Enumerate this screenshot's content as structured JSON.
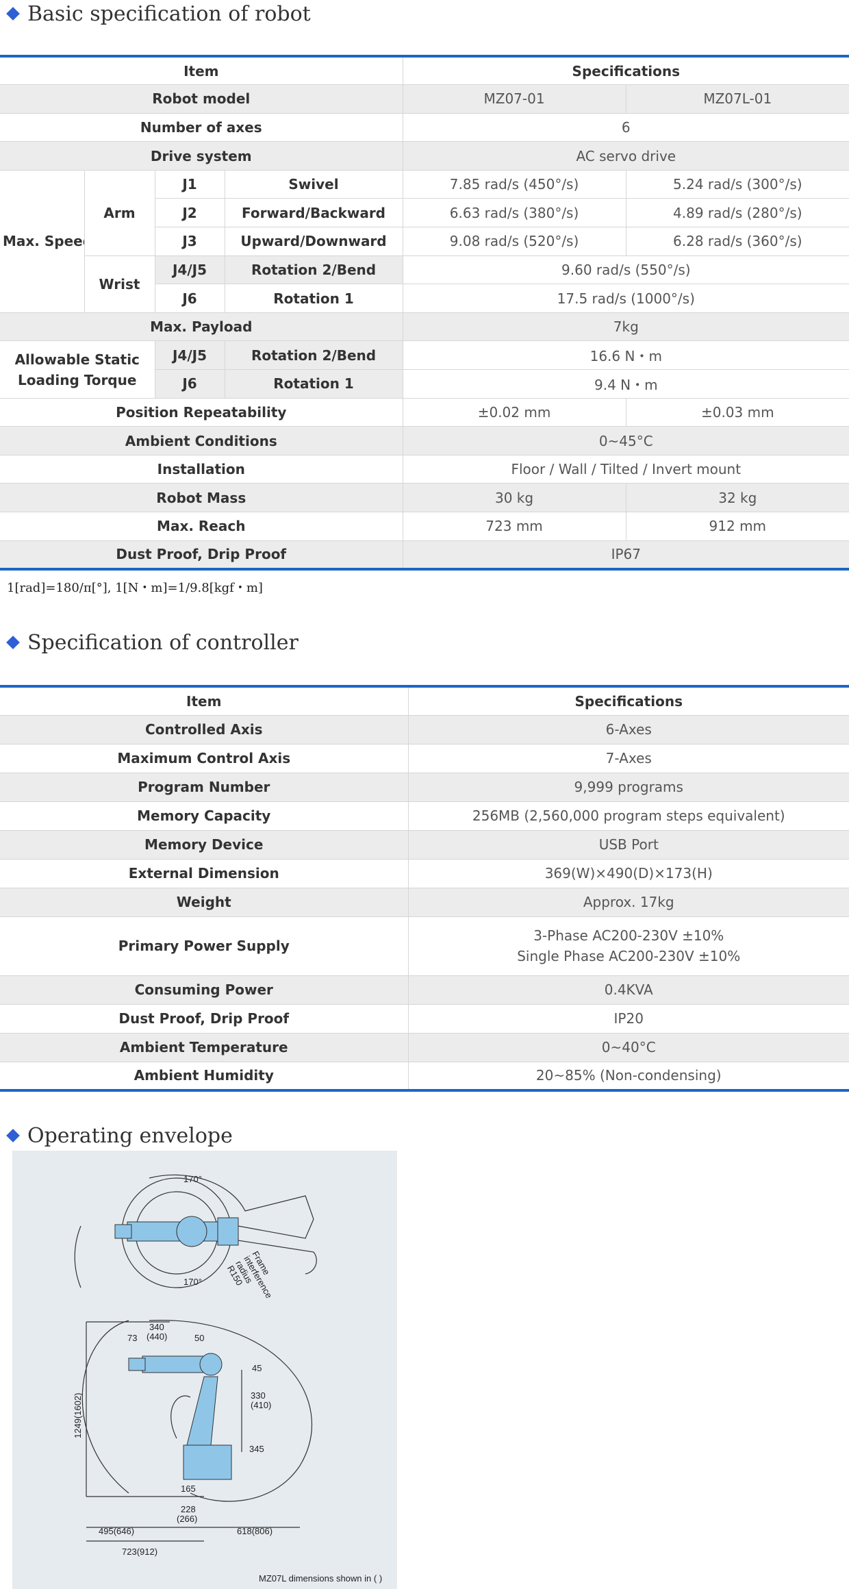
{
  "sections": {
    "robot_title": "Basic specification of robot",
    "controller_title": "Specification of controller",
    "envelope_title": "Operating envelope"
  },
  "robot": {
    "header": {
      "item": "Item",
      "spec": "Specifications"
    },
    "model": {
      "label": "Robot model",
      "a": "MZ07-01",
      "b": "MZ07L-01"
    },
    "axes": {
      "label": "Number of axes",
      "value": "6"
    },
    "drive": {
      "label": "Drive system",
      "value": "AC servo drive"
    },
    "max_speed": {
      "label": "Max. Speed",
      "arm_label": "Arm",
      "wrist_label": "Wrist",
      "j1": {
        "joint": "J1",
        "motion": "Swivel",
        "a": "7.85 rad/s (450°/s)",
        "b": "5.24 rad/s (300°/s)"
      },
      "j2": {
        "joint": "J2",
        "motion": "Forward/Backward",
        "a": "6.63 rad/s (380°/s)",
        "b": "4.89 rad/s (280°/s)"
      },
      "j3": {
        "joint": "J3",
        "motion": "Upward/Downward",
        "a": "9.08 rad/s (520°/s)",
        "b": "6.28 rad/s (360°/s)"
      },
      "j45": {
        "joint": "J4/J5",
        "motion": "Rotation 2/Bend",
        "value": "9.60 rad/s (550°/s)"
      },
      "j6": {
        "joint": "J6",
        "motion": "Rotation 1",
        "value": "17.5 rad/s (1000°/s)"
      }
    },
    "payload": {
      "label": "Max. Payload",
      "value": "7kg"
    },
    "torque": {
      "label": "Allowable Static Loading Torque",
      "j45": {
        "joint": "J4/J5",
        "motion": "Rotation 2/Bend",
        "value": "16.6 N・m"
      },
      "j6": {
        "joint": "J6",
        "motion": "Rotation 1",
        "value": "9.4 N・m"
      }
    },
    "repeat": {
      "label": "Position Repeatability",
      "a": "±0.02 mm",
      "b": "±0.03 mm"
    },
    "ambient": {
      "label": "Ambient Conditions",
      "value": "0~45°C"
    },
    "install": {
      "label": "Installation",
      "value": "Floor / Wall / Tilted / Invert mount"
    },
    "mass": {
      "label": "Robot Mass",
      "a": "30 kg",
      "b": "32 kg"
    },
    "reach": {
      "label": "Max. Reach",
      "a": "723 mm",
      "b": "912 mm"
    },
    "dust": {
      "label": "Dust Proof, Drip Proof",
      "value": "IP67"
    },
    "note": "1[rad]=180/π[°], 1[N・m]=1/9.8[kgf・m]"
  },
  "controller": {
    "header": {
      "item": "Item",
      "spec": "Specifications"
    },
    "rows": [
      {
        "label": "Controlled Axis",
        "value": "6-Axes"
      },
      {
        "label": "Maximum Control Axis",
        "value": "7-Axes"
      },
      {
        "label": "Program Number",
        "value": "9,999 programs"
      },
      {
        "label": "Memory Capacity",
        "value": "256MB (2,560,000 program steps equivalent)"
      },
      {
        "label": "Memory Device",
        "value": "USB Port"
      },
      {
        "label": "External Dimension",
        "value": "369(W)×490(D)×173(H)"
      },
      {
        "label": "Weight",
        "value": "Approx. 17kg"
      }
    ],
    "power": {
      "label": "Primary Power Supply",
      "line1": "3-Phase AC200-230V  ±10%",
      "line2": "Single Phase AC200-230V  ±10%"
    },
    "rows2": [
      {
        "label": "Consuming Power",
        "value": "0.4KVA"
      },
      {
        "label": "Dust Proof, Drip Proof",
        "value": "IP20"
      },
      {
        "label": "Ambient Temperature",
        "value": "0~40°C"
      },
      {
        "label": "Ambient Humidity",
        "value": "20~85% (Non-condensing)"
      }
    ]
  },
  "envelope": {
    "top_angle": "170°",
    "bottom_angle": "170°",
    "frame_label_1": "Frame",
    "frame_label_2": "interference",
    "frame_label_3": "radius",
    "frame_label_4": "R150",
    "dims": {
      "d340": "340",
      "d440": "(440)",
      "d73": "73",
      "d50": "50",
      "d45": "45",
      "d330": "330",
      "d410": "(410)",
      "d345": "345",
      "d1249": "1249(1602)",
      "d165": "165",
      "d228": "228",
      "d266": "(266)",
      "d495": "495(646)",
      "d618": "618(806)",
      "d723": "723(912)"
    },
    "caption": "MZ07L dimensions shown in ( )"
  },
  "colors": {
    "accent": "#1b67c4",
    "diamond": "#2f5fd6",
    "row_gray": "#ececec",
    "robot_body": "#8fc6e8"
  }
}
